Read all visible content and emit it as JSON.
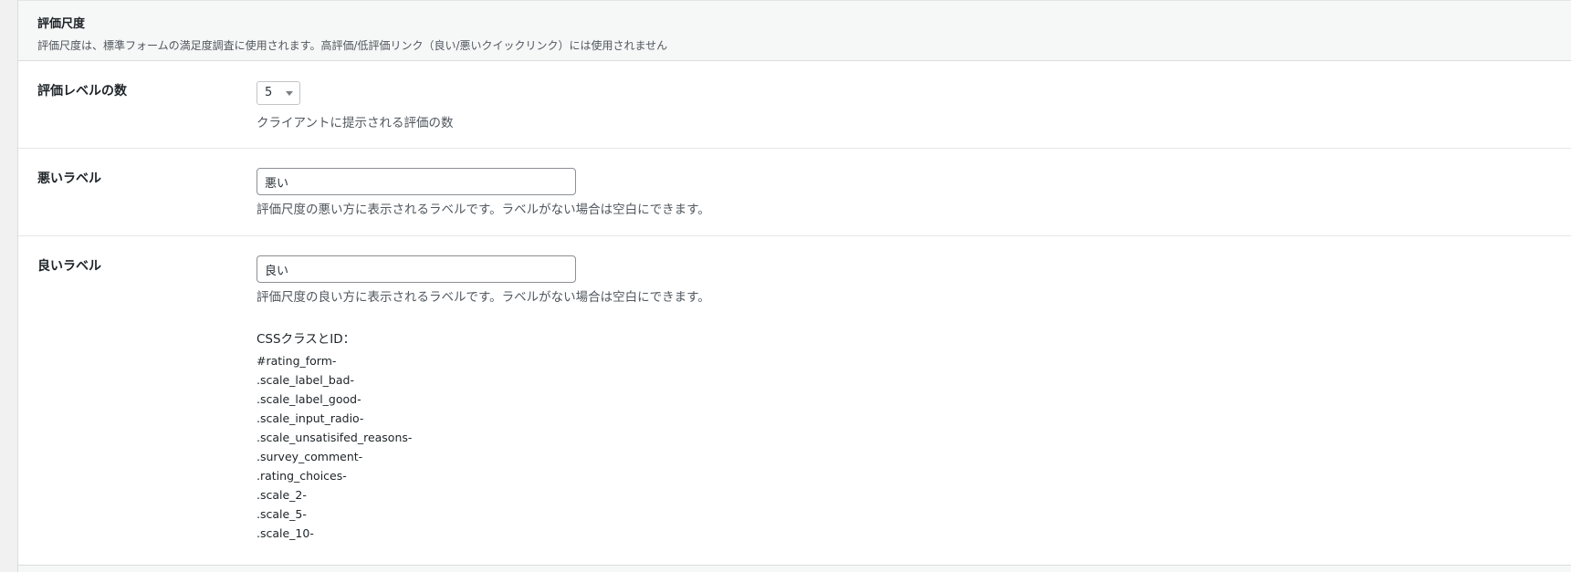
{
  "section": {
    "title": "評価尺度",
    "description": "評価尺度は、標準フォームの満足度調査に使用されます。高評価/低評価リンク（良い/悪いクイックリンク）には使用されません"
  },
  "rating_levels": {
    "label": "評価レベルの数",
    "selected": "5",
    "help": "クライアントに提示される評価の数"
  },
  "bad_label": {
    "label": "悪いラベル",
    "value": "悪い",
    "help": "評価尺度の悪い方に表示されるラベルです。ラベルがない場合は空白にできます。"
  },
  "good_label": {
    "label": "良いラベル",
    "value": "良い",
    "help": "評価尺度の良い方に表示されるラベルです。ラベルがない場合は空白にできます。"
  },
  "css_info": {
    "title": "CSSクラスとID：",
    "items": [
      "#rating_form-",
      ".scale_label_bad-",
      ".scale_label_good-",
      ".scale_input_radio-",
      ".scale_unsatisifed_reasons-",
      ".survey_comment-",
      ".rating_choices-",
      ".scale_2-",
      ".scale_5-",
      ".scale_10-"
    ]
  }
}
